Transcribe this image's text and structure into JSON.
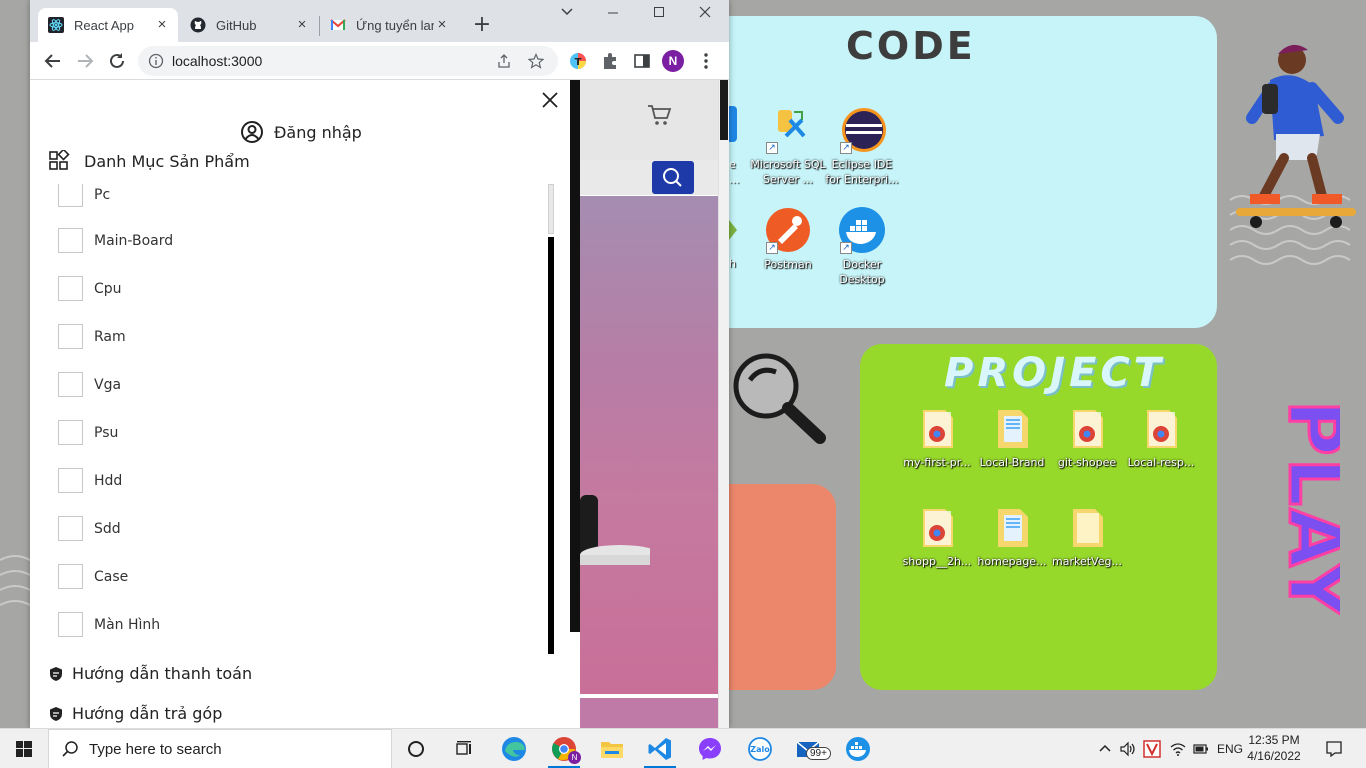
{
  "desktop": {
    "code_title": "CODE",
    "project_title": "PROJECT",
    "play_text": "PLAY",
    "icons": [
      {
        "name": "sql-server",
        "label": "Microsoft SQL Server ..."
      },
      {
        "name": "eclipse",
        "label": "Eclipse IDE for Enterpri..."
      },
      {
        "name": "postman",
        "label": "Postman"
      },
      {
        "name": "docker",
        "label": "Docker Desktop"
      },
      {
        "name": "my-first-pr",
        "label": "my-first-pr..."
      },
      {
        "name": "local-brand",
        "label": "Local-Brand"
      },
      {
        "name": "git-shopee",
        "label": "git-shopee"
      },
      {
        "name": "local-resp",
        "label": "Local-resp..."
      },
      {
        "name": "shopp-2h",
        "label": "shopp__2h..."
      },
      {
        "name": "homepage",
        "label": "homepage..."
      },
      {
        "name": "marketveg",
        "label": "marketVeg..."
      }
    ],
    "partial_labels": {
      "e": "e",
      "dots": "...",
      "h": "h"
    }
  },
  "browser": {
    "tabs": [
      {
        "title": "React App",
        "active": true
      },
      {
        "title": "GitHub",
        "active": false
      },
      {
        "title": "Ứng tuyển lan",
        "active": false
      }
    ],
    "url": "localhost:3000",
    "profile_initial": "N"
  },
  "drawer": {
    "login_label": "Đăng nhập",
    "category_header": "Danh Mục Sản Phẩm",
    "categories": [
      "Pc",
      "Main-Board",
      "Cpu",
      "Ram",
      "Vga",
      "Psu",
      "Hdd",
      "Sdd",
      "Case",
      "Màn Hình"
    ],
    "payment_guide": "Hướng dẫn thanh toán",
    "installment_guide": "Hướng dẫn trả góp"
  },
  "taskbar": {
    "search_placeholder": "Type here to search",
    "language": "ENG",
    "time": "12:35 PM",
    "date": "4/16/2022",
    "mail_badge": "99+",
    "zalo_label": "Zalo",
    "chrome_badge": "N"
  },
  "colors": {
    "code_panel": "#c6f4f8",
    "project_panel": "#97d92b",
    "orange_panel": "#ec876b",
    "search_button": "#1d3aa8",
    "play_fill": "#7b4ff0",
    "play_outline": "#ff3fa4"
  }
}
